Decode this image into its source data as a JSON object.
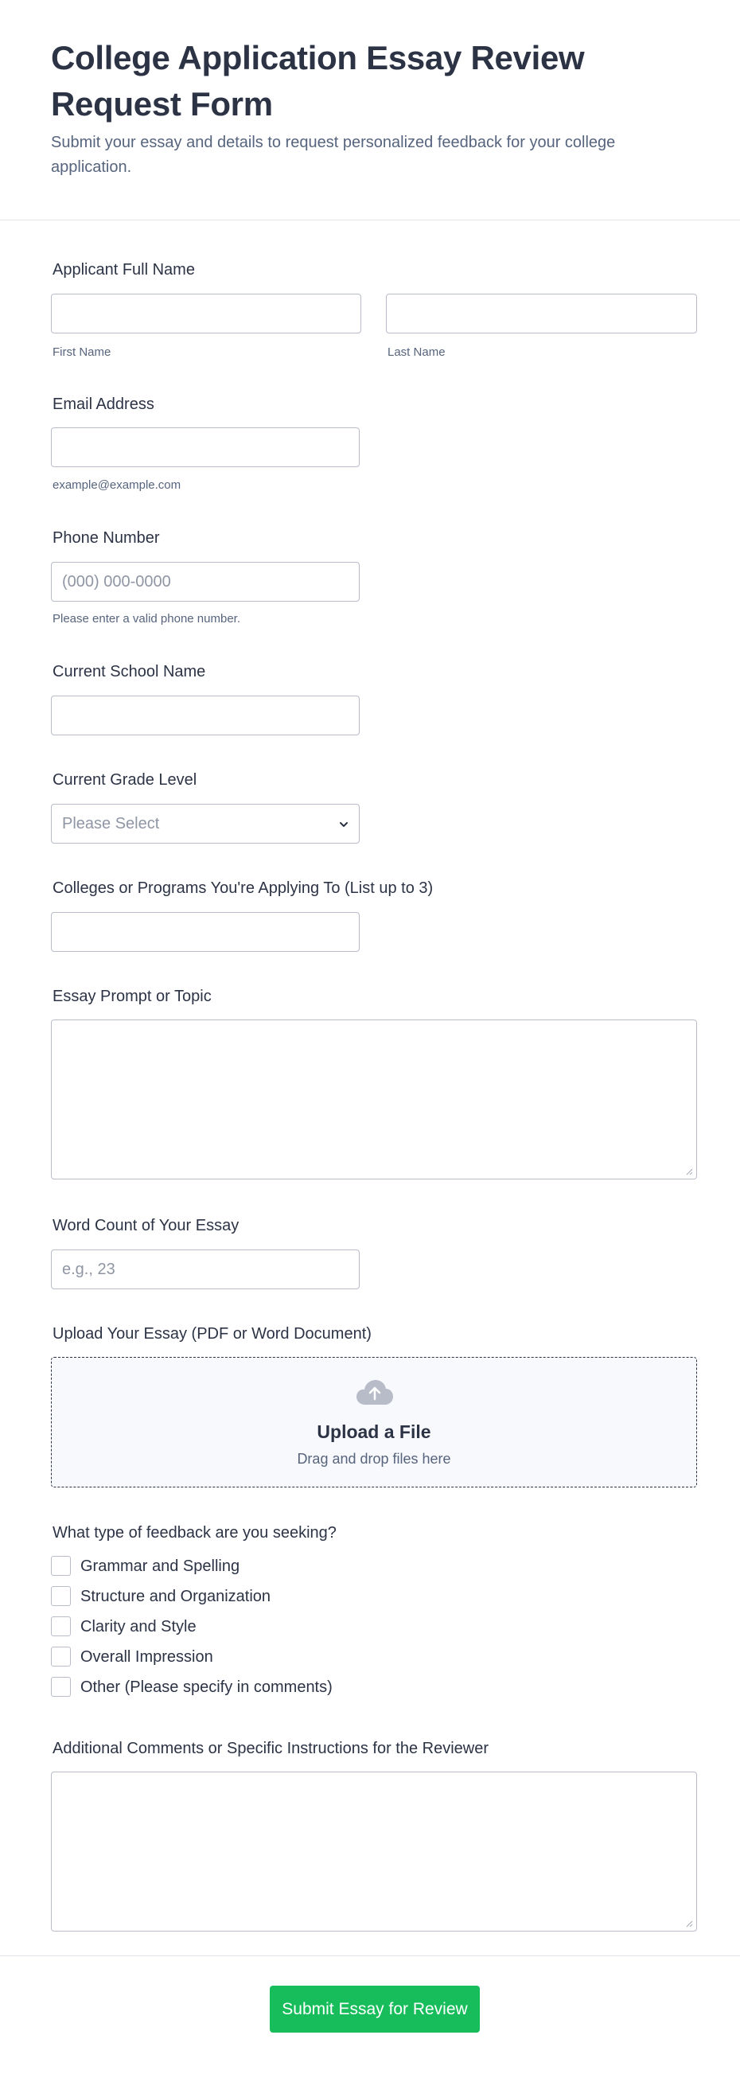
{
  "form": {
    "title": "College Application Essay Review Request Form",
    "subtitle": "Submit your essay and details to request personalized feedback for your college application."
  },
  "fields": {
    "full_name": {
      "label": "Applicant Full Name",
      "first_sublabel": "First Name",
      "last_sublabel": "Last Name",
      "first_value": "",
      "last_value": ""
    },
    "email": {
      "label": "Email Address",
      "sublabel": "example@example.com",
      "value": ""
    },
    "phone": {
      "label": "Phone Number",
      "placeholder": "(000) 000-0000",
      "sublabel": "Please enter a valid phone number.",
      "value": ""
    },
    "school": {
      "label": "Current School Name",
      "value": ""
    },
    "grade": {
      "label": "Current Grade Level",
      "selected": "Please Select"
    },
    "colleges": {
      "label": "Colleges or Programs You're Applying To (List up to 3)",
      "value": ""
    },
    "prompt": {
      "label": "Essay Prompt or Topic",
      "value": ""
    },
    "word_count": {
      "label": "Word Count of Your Essay",
      "placeholder": "e.g., 23",
      "value": ""
    },
    "upload": {
      "label": "Upload Your Essay (PDF or Word Document)",
      "title": "Upload a File",
      "hint": "Drag and drop files here",
      "icon": "cloud-upload-icon"
    },
    "feedback": {
      "label": "What type of feedback are you seeking?",
      "options": [
        {
          "label": "Grammar and Spelling",
          "checked": false
        },
        {
          "label": "Structure and Organization",
          "checked": false
        },
        {
          "label": "Clarity and Style",
          "checked": false
        },
        {
          "label": "Overall Impression",
          "checked": false
        },
        {
          "label": "Other (Please specify in comments)",
          "checked": false
        }
      ]
    },
    "comments": {
      "label": "Additional Comments or Specific Instructions for the Reviewer",
      "value": ""
    }
  },
  "submit": {
    "label": "Submit Essay for Review"
  },
  "colors": {
    "text": "#2c3345",
    "muted": "#57647e",
    "border": "#b8bdc9",
    "upload_bg": "#f8f9fc",
    "submit_bg": "#18bd5b"
  }
}
